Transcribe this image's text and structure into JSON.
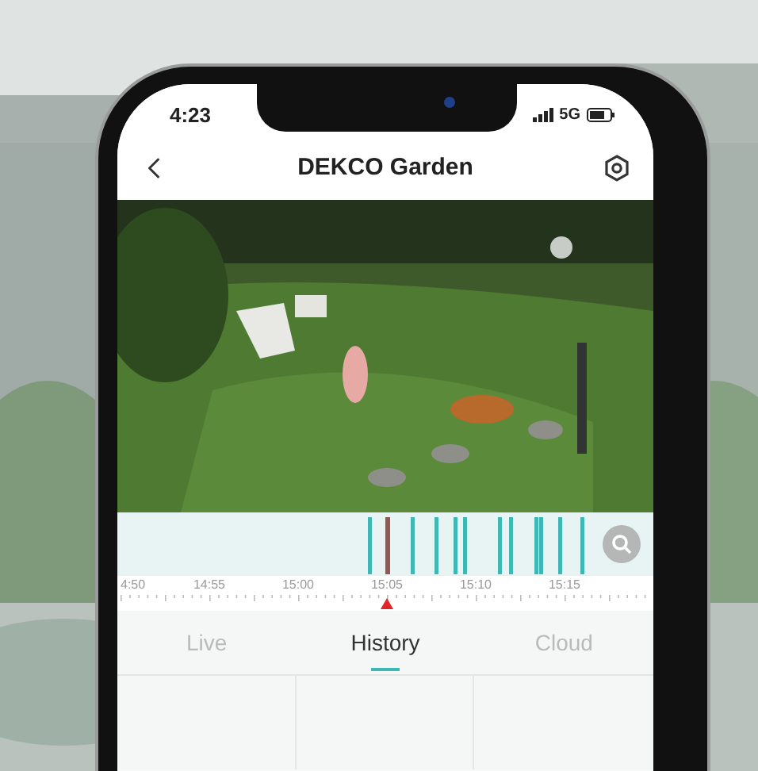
{
  "status_bar": {
    "time": "4:23",
    "network": "5G"
  },
  "header": {
    "title": "DEKCO Garden"
  },
  "timeline": {
    "labels": [
      "4:50",
      "14:55",
      "15:00",
      "15:05",
      "15:10",
      "15:15"
    ]
  },
  "tabs": [
    {
      "label": "Live",
      "selected": false
    },
    {
      "label": "History",
      "selected": true
    },
    {
      "label": "Cloud",
      "selected": false
    }
  ]
}
